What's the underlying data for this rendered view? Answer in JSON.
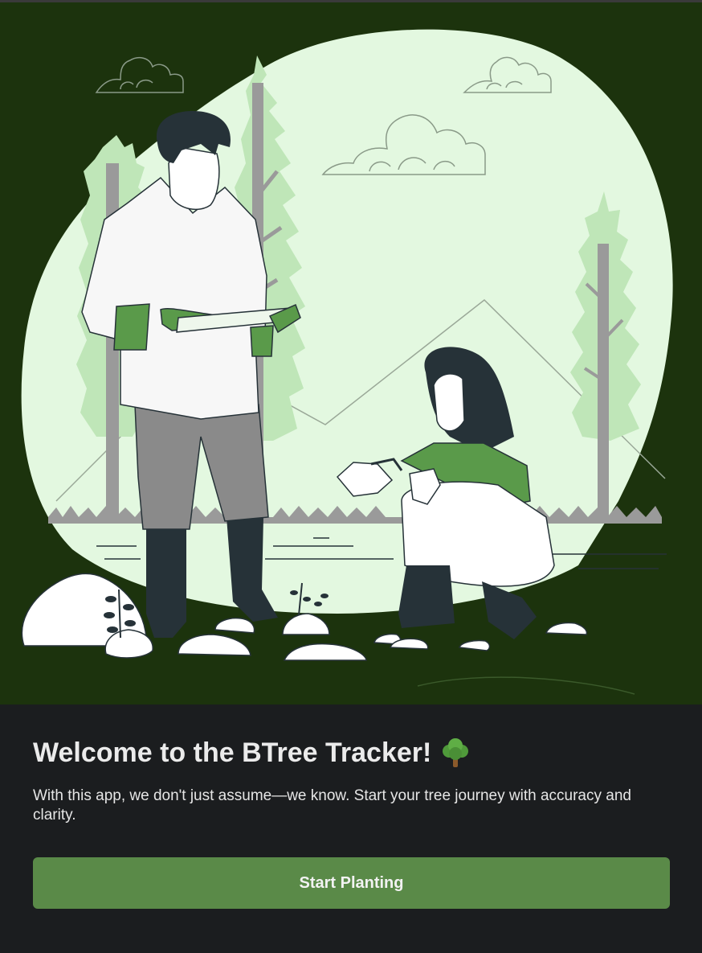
{
  "hero": {
    "illustration": "two-people-planting-trees-illustration",
    "colors": {
      "background": "#1c330d",
      "circle": "#e3f8e0",
      "foliage": "#bfe6b8",
      "accent_green": "#5a9a4a",
      "outline": "#263238"
    }
  },
  "welcome": {
    "title": "Welcome to the BTree Tracker!",
    "title_icon": "deciduous-tree-emoji",
    "description": "With this app, we don't just assume—we know. Start your tree journey with accuracy and clarity."
  },
  "actions": {
    "start_label": "Start Planting"
  },
  "theme": {
    "page_background": "#1b1d1f",
    "button_color": "#5a8a48",
    "text_color": "#ebebeb"
  }
}
